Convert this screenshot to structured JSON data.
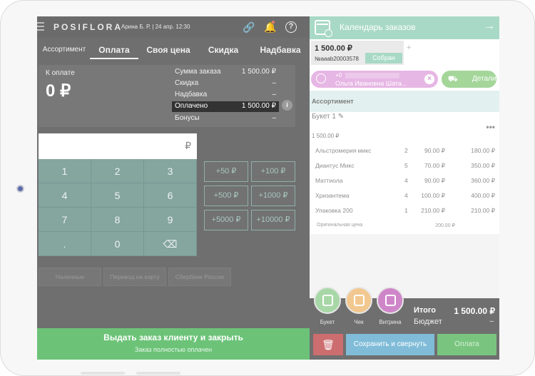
{
  "topbar": {
    "logo": "POSIFLORA",
    "user_info": "Арина Б. Р. | 24 апр. 12:30",
    "link_glyph": "🔗",
    "bell_glyph": "🔔",
    "help_glyph": "?"
  },
  "tabs": [
    {
      "label": "Ассортимент",
      "active": false
    },
    {
      "label": "Оплата",
      "active": true
    },
    {
      "label": "Своя цена",
      "active": false
    },
    {
      "label": "Скидка",
      "active": false
    },
    {
      "label": "Надбавка",
      "active": false
    }
  ],
  "summary": {
    "to_pay_label": "К оплате",
    "to_pay_amount": "0 ₽",
    "rows": [
      {
        "label": "Сумма заказа",
        "value": "1 500.00 ₽"
      },
      {
        "label": "Скидка",
        "value": "–"
      },
      {
        "label": "Надбавка",
        "value": "–"
      },
      {
        "label": "Оплачено",
        "value": "1 500.00 ₽"
      },
      {
        "label": "Бонусы",
        "value": "–"
      }
    ],
    "info_glyph": "i"
  },
  "amount_input": {
    "currency": "₽"
  },
  "keypad": [
    "1",
    "2",
    "3",
    "4",
    "5",
    "6",
    "7",
    "8",
    "9",
    ".",
    "0",
    "⌫"
  ],
  "quick_amounts": [
    "+50 ₽",
    "+100 ₽",
    "+500 ₽",
    "+1000 ₽",
    "+5000 ₽",
    "+10000 ₽"
  ],
  "payment_methods": [
    "Наличные",
    "Перевод на карту",
    "Сбербанк России"
  ],
  "issue_button": {
    "title": "Выдать заказ клиенту и закрыть",
    "subtitle": "Заказ полностью оплачен"
  },
  "calendar": {
    "title": "Календарь заказов",
    "arrow": "→"
  },
  "order": {
    "sum": "1 500.00 ₽",
    "number": "№aaab20003578",
    "status": "Собран",
    "add_glyph": "+"
  },
  "client": {
    "phone": "+0",
    "name": "Ольга Ивановна Шата...",
    "remove_glyph": "×"
  },
  "details_button": {
    "label": "Детали",
    "icon": "⛟"
  },
  "assortment_header": "Ассортимент",
  "bouquet": {
    "title": "Букет 1",
    "edit_glyph": "✎",
    "price": "1 500.00 ₽",
    "menu_glyph": "•••",
    "items": [
      {
        "name": "Альстромерия микс",
        "qty": "2",
        "price": "90.00 ₽",
        "total": "180.00 ₽"
      },
      {
        "name": "Диантус Микс",
        "qty": "5",
        "price": "70.00 ₽",
        "total": "350.00 ₽"
      },
      {
        "name": "Маттиола",
        "qty": "4",
        "price": "90.00 ₽",
        "total": "360.00 ₽"
      },
      {
        "name": "Хризантема",
        "qty": "4",
        "price": "100.00 ₽",
        "total": "400.00 ₽"
      },
      {
        "name": "Упаковка 200",
        "qty": "1",
        "price": "210.00 ₽",
        "total": "210.00 ₽"
      }
    ],
    "original_price_label": "Оригинальная цена",
    "original_price_value": "200.00 ₽"
  },
  "footer": {
    "buttons": [
      {
        "label": "Букет",
        "color": "#a7d7a6"
      },
      {
        "label": "Чек",
        "color": "#f2c890"
      },
      {
        "label": "Витрина",
        "color": "#cf86c9"
      }
    ],
    "total_label": "Итого",
    "total_value": "1 500.00 ₽",
    "budget_label": "Бюджет",
    "budget_value": "–",
    "trash_glyph": "🗑",
    "save_label": "Сохранить и свернуть",
    "pay_label": "Оплата"
  },
  "colors": {
    "accent_green": "#6cc378",
    "calendar_mint": "#a8d9c6",
    "client_pink": "#e6b6e4",
    "keypad_teal": "#85a59f",
    "danger_red": "#cc6d6f",
    "save_blue": "#80bcd8"
  }
}
